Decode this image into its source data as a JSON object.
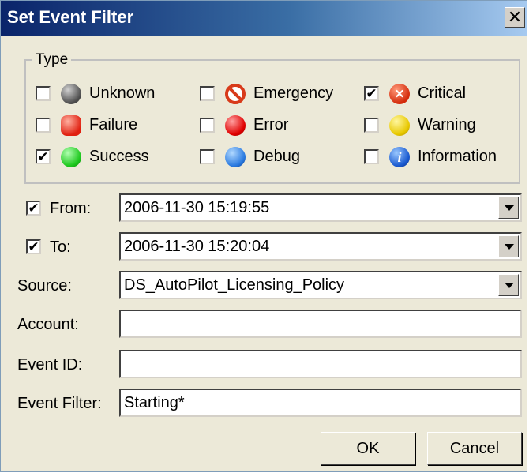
{
  "window": {
    "title": "Set Event Filter",
    "close_glyph": "✕"
  },
  "type_group": {
    "label": "Type",
    "items": [
      {
        "label": "Unknown",
        "checked": false,
        "icon": "unknown-gray-icon"
      },
      {
        "label": "Emergency",
        "checked": false,
        "icon": "emergency-no-entry-icon"
      },
      {
        "label": "Critical",
        "checked": true,
        "icon": "critical-x-icon"
      },
      {
        "label": "Failure",
        "checked": false,
        "icon": "failure-red-octagon-icon"
      },
      {
        "label": "Error",
        "checked": false,
        "icon": "error-red-icon"
      },
      {
        "label": "Warning",
        "checked": false,
        "icon": "warning-yellow-icon"
      },
      {
        "label": "Success",
        "checked": true,
        "icon": "success-green-icon"
      },
      {
        "label": "Debug",
        "checked": false,
        "icon": "debug-blue-icon"
      },
      {
        "label": "Information",
        "checked": false,
        "icon": "information-i-icon"
      }
    ],
    "info_glyph": "i",
    "critical_glyph": "✕"
  },
  "from": {
    "label": "From:",
    "checked": true,
    "value": "2006-11-30 15:19:55"
  },
  "to": {
    "label": "To:",
    "checked": true,
    "value": "2006-11-30 15:20:04"
  },
  "source": {
    "label": "Source:",
    "value": "DS_AutoPilot_Licensing_Policy"
  },
  "account": {
    "label": "Account:",
    "value": ""
  },
  "event_id": {
    "label": "Event ID:",
    "value": ""
  },
  "event_filter": {
    "label": "Event Filter:",
    "value": "Starting*"
  },
  "buttons": {
    "ok": "OK",
    "cancel": "Cancel"
  },
  "check_glyph": "✔",
  "colors": {
    "title_start": "#0a246a",
    "title_end": "#a6caf0",
    "dialog_bg": "#ece9d8"
  }
}
